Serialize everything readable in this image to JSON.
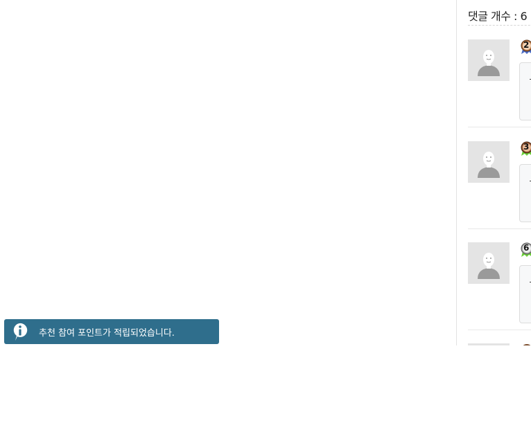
{
  "comments_panel": {
    "count_label": "댓글 개수 : 6",
    "comments": [
      {
        "level": "2",
        "badge_color": "#3a5fb0",
        "ribbon_color": "#4a6bc4",
        "preview": "-"
      },
      {
        "level": "3",
        "badge_color": "#7a4b2a",
        "ribbon_color": "#6ccf3a",
        "preview": "-"
      },
      {
        "level": "6",
        "badge_color": "#9a9a9a",
        "ribbon_color": "#6ccf3a",
        "preview": "-"
      }
    ]
  },
  "toast": {
    "icon": "info-icon",
    "message": "추천 참여 포인트가 적립되었습니다.",
    "background": "#2f6e8c"
  }
}
